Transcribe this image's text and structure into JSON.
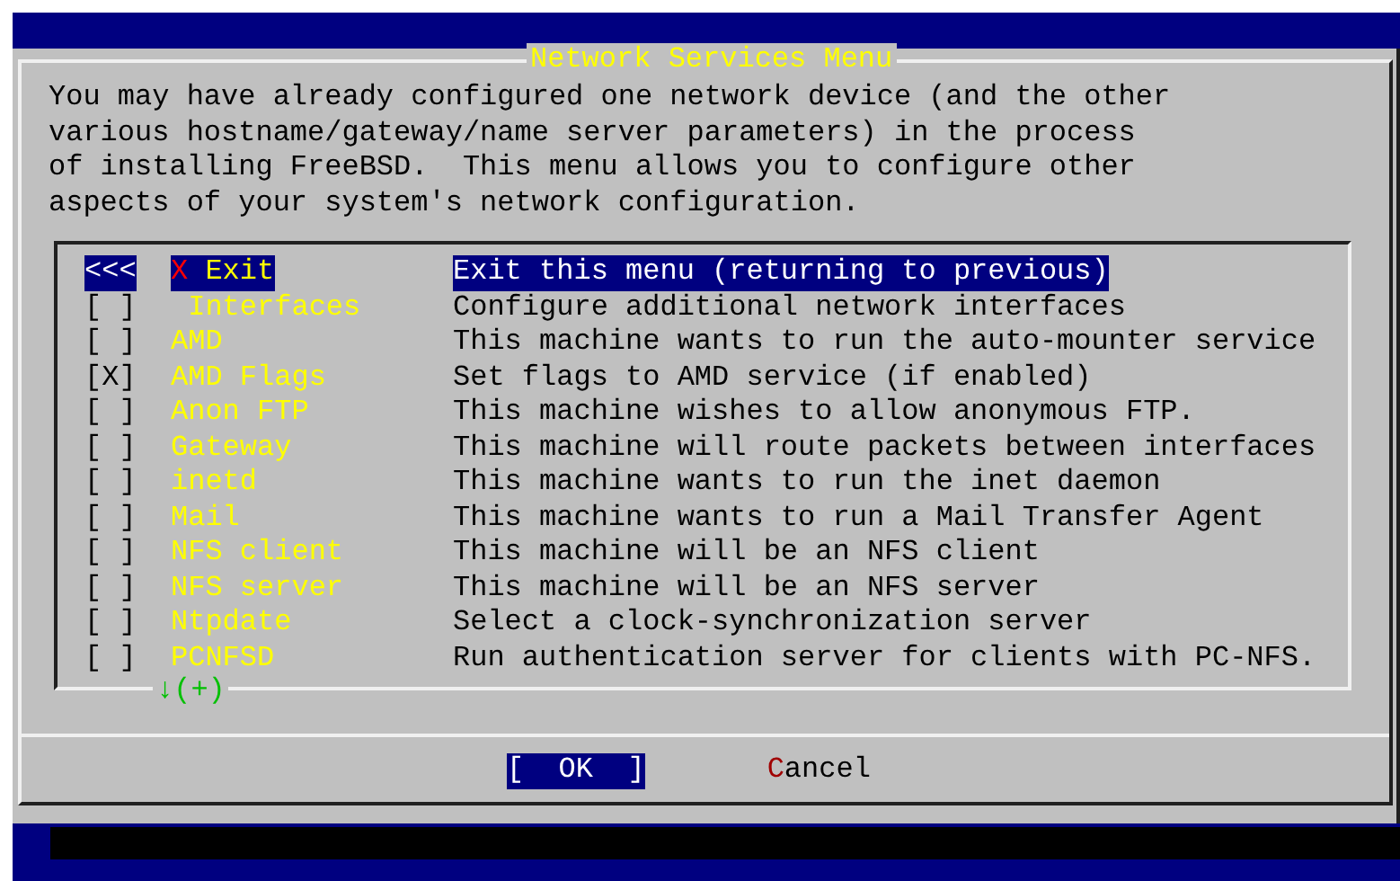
{
  "dialog": {
    "title": "Network Services Menu",
    "text": [
      "You may have already configured one network device (and the other",
      "various hostname/gateway/name server parameters) in the process",
      "of installing FreeBSD.  This menu allows you to configure other",
      "aspects of your system's network configuration."
    ],
    "items": [
      {
        "kind": "exit",
        "marker": "<<<",
        "hotkey": "X",
        "name": "Exit",
        "description": "Exit this menu (returning to previous)",
        "selected": true
      },
      {
        "kind": "checkbox",
        "box_left": "[",
        "box_right": "]",
        "checked": false,
        "name": " Interfaces",
        "description": "Configure additional network interfaces",
        "selected": false
      },
      {
        "kind": "checkbox",
        "box_left": "[",
        "box_right": "]",
        "checked": false,
        "name": "AMD",
        "description": "This machine wants to run the auto-mounter service",
        "selected": false
      },
      {
        "kind": "checkbox",
        "box_left": "[",
        "box_right": "]",
        "checked": true,
        "name": "AMD Flags",
        "description": "Set flags to AMD service (if enabled)",
        "selected": false
      },
      {
        "kind": "checkbox",
        "box_left": "[",
        "box_right": "]",
        "checked": false,
        "name": "Anon FTP",
        "description": "This machine wishes to allow anonymous FTP.",
        "selected": false
      },
      {
        "kind": "checkbox",
        "box_left": "[",
        "box_right": "]",
        "checked": false,
        "name": "Gateway",
        "description": "This machine will route packets between interfaces",
        "selected": false
      },
      {
        "kind": "checkbox",
        "box_left": "[",
        "box_right": "]",
        "checked": false,
        "name": "inetd",
        "description": "This machine wants to run the inet daemon",
        "selected": false
      },
      {
        "kind": "checkbox",
        "box_left": "[",
        "box_right": "]",
        "checked": false,
        "name": "Mail",
        "description": "This machine wants to run a Mail Transfer Agent",
        "selected": false
      },
      {
        "kind": "checkbox",
        "box_left": "[",
        "box_right": "]",
        "checked": false,
        "name": "NFS client",
        "description": "This machine will be an NFS client",
        "selected": false
      },
      {
        "kind": "checkbox",
        "box_left": "[",
        "box_right": "]",
        "checked": false,
        "name": "NFS server",
        "description": "This machine will be an NFS server",
        "selected": false
      },
      {
        "kind": "checkbox",
        "box_left": "[",
        "box_right": "]",
        "checked": false,
        "name": "Ntpdate",
        "description": "Select a clock-synchronization server",
        "selected": false
      },
      {
        "kind": "checkbox",
        "box_left": "[",
        "box_right": "]",
        "checked": false,
        "name": "PCNFSD",
        "description": "Run authentication server for clients with PC-NFS.",
        "selected": false
      }
    ],
    "check_mark": "X",
    "scroll_indicator": "↓(+)",
    "buttons": [
      {
        "label": "[  OK  ]",
        "selected": true,
        "hotkey_first": false
      },
      {
        "label": "Cancel",
        "selected": false,
        "hotkey_first": true
      }
    ]
  }
}
